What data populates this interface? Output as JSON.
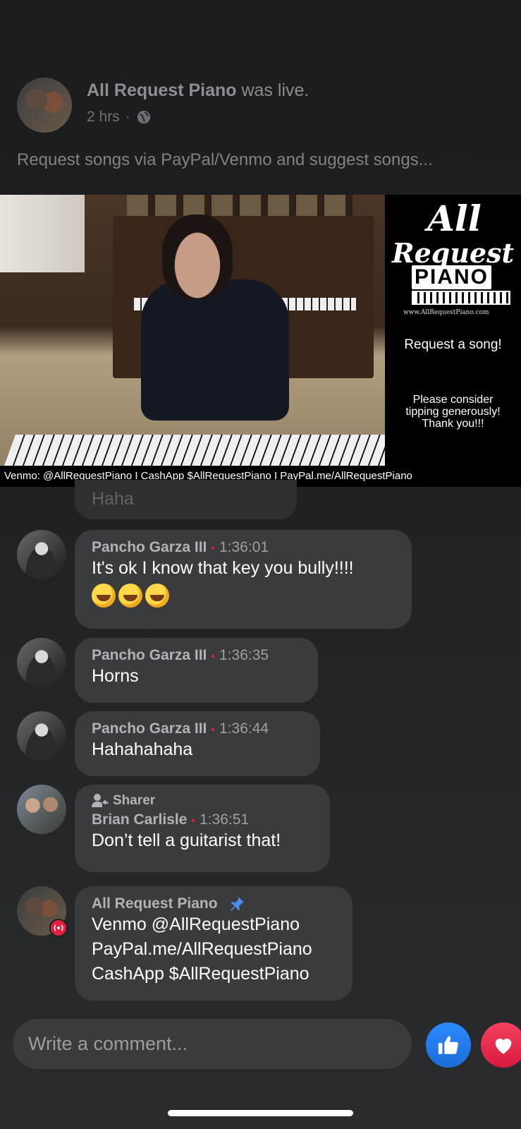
{
  "post": {
    "author": "All Request Piano",
    "status": " was live.",
    "time": "2 hrs",
    "separator": "·",
    "description": "Request songs via PayPal/Venmo and suggest songs..."
  },
  "video": {
    "logo_all": "All",
    "logo_request": "Request",
    "logo_piano": "PIANO",
    "logo_url": "www.AllRequestPiano.com",
    "request_song": "Request a song!",
    "tip_line1": "Please consider",
    "tip_line2": "tipping generously!",
    "tip_line3": "Thank you!!!",
    "footer": "Venmo: @AllRequestPiano  I  CashApp $AllRequestPiano  I  PayPal.me/AllRequestPiano"
  },
  "ghost_comment": {
    "text": "Haha"
  },
  "comments": [
    {
      "name": "Pancho Garza III",
      "time": "1:36:01",
      "text": "It's ok I know that key you bully!!!!"
    },
    {
      "name": "Pancho Garza III",
      "time": "1:36:35",
      "text": "Horns"
    },
    {
      "name": "Pancho Garza III",
      "time": "1:36:44",
      "text": "Hahahahaha"
    },
    {
      "badge": "Sharer",
      "name": "Brian Carlisle",
      "time": "1:36:51",
      "text": "Don’t tell a guitarist that!"
    },
    {
      "name": "All Request Piano",
      "lines": [
        "Venmo @AllRequestPiano",
        "PayPal.me/AllRequestPiano",
        "CashApp $AllRequestPiano"
      ]
    }
  ],
  "composer": {
    "placeholder": "Write a comment..."
  },
  "colors": {
    "background": "#1d1e20",
    "bubble": "#3a3b3c",
    "live_dot": "#e41e3f",
    "like": "#2d88ff",
    "love": "#f3425f"
  }
}
